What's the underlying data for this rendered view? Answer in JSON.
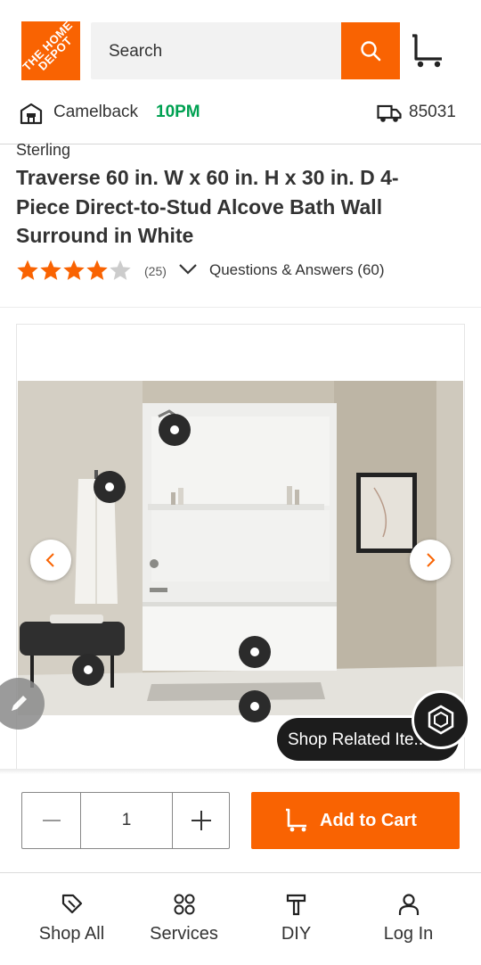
{
  "header": {
    "logo_text": "THE HOME DEPOT",
    "search_placeholder": "Search",
    "store_name": "Camelback",
    "store_hours": "10PM",
    "zip": "85031"
  },
  "product": {
    "brand": "Sterling",
    "title": "Traverse 60 in. W x 60 in. H x 30 in. D 4-Piece Direct-to-Stud Alcove Bath Wall Surround in White",
    "rating_stars": 4,
    "rating_max": 5,
    "review_count": "(25)",
    "qa_link": "Questions & Answers (60)"
  },
  "gallery": {
    "shop_related_label": "Shop Related Ite..."
  },
  "cart": {
    "quantity": "1",
    "add_to_cart_label": "Add to Cart"
  },
  "bottom_nav": {
    "items": [
      {
        "label": "Shop All",
        "icon": "tag-icon"
      },
      {
        "label": "Services",
        "icon": "grid-circles-icon"
      },
      {
        "label": "DIY",
        "icon": "hammer-icon"
      },
      {
        "label": "Log In",
        "icon": "person-icon"
      }
    ]
  },
  "colors": {
    "brand_orange": "#f96302",
    "hours_green": "#00a152",
    "star_orange": "#f96302",
    "star_empty": "#cccccc"
  }
}
